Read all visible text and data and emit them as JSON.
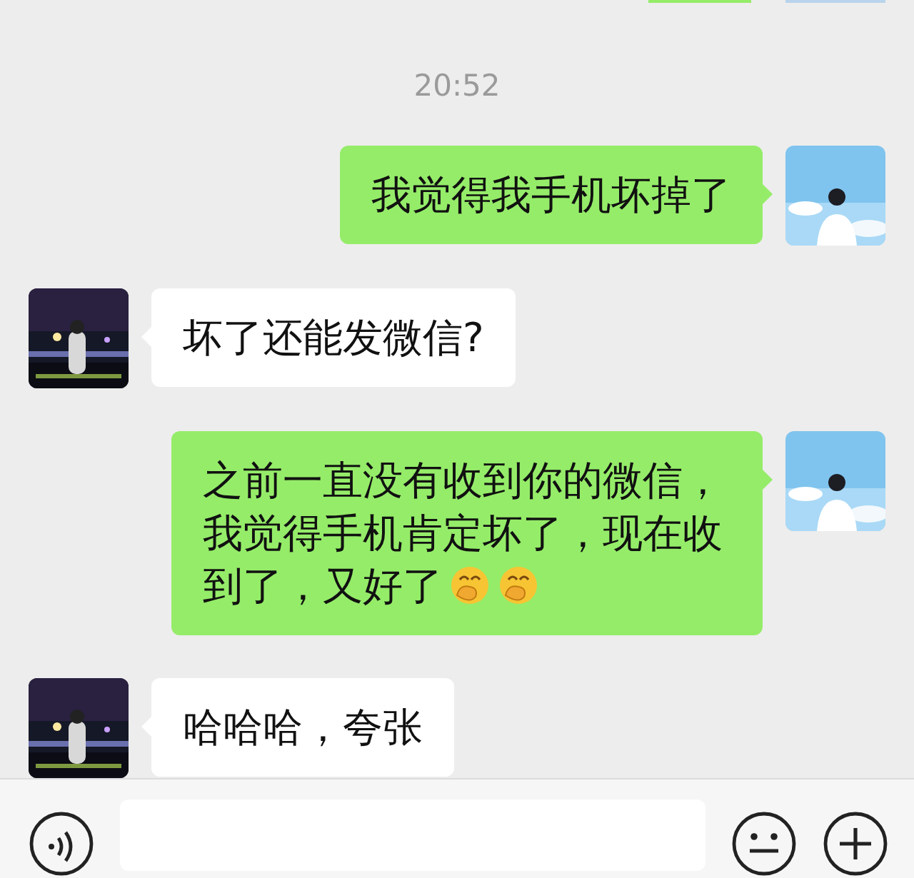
{
  "messages": [
    {
      "kind": "partial_sent"
    },
    {
      "kind": "time",
      "text": "20:52"
    },
    {
      "kind": "sent",
      "parts": [
        {
          "kind": "text",
          "text": "我觉得我手机坏掉了"
        }
      ]
    },
    {
      "kind": "received",
      "parts": [
        {
          "kind": "text",
          "text": "坏了还能发微信?"
        }
      ]
    },
    {
      "kind": "sent",
      "parts": [
        {
          "kind": "paragraph",
          "text": "之前一直没有收到你的微信，我觉得手机肯定坏了，现在收"
        },
        {
          "kind": "text",
          "text": "到了，又好了"
        },
        {
          "kind": "emoji"
        },
        {
          "kind": "emoji"
        }
      ]
    },
    {
      "kind": "received",
      "parts": [
        {
          "kind": "text",
          "text": "哈哈哈，夸张"
        }
      ]
    }
  ]
}
